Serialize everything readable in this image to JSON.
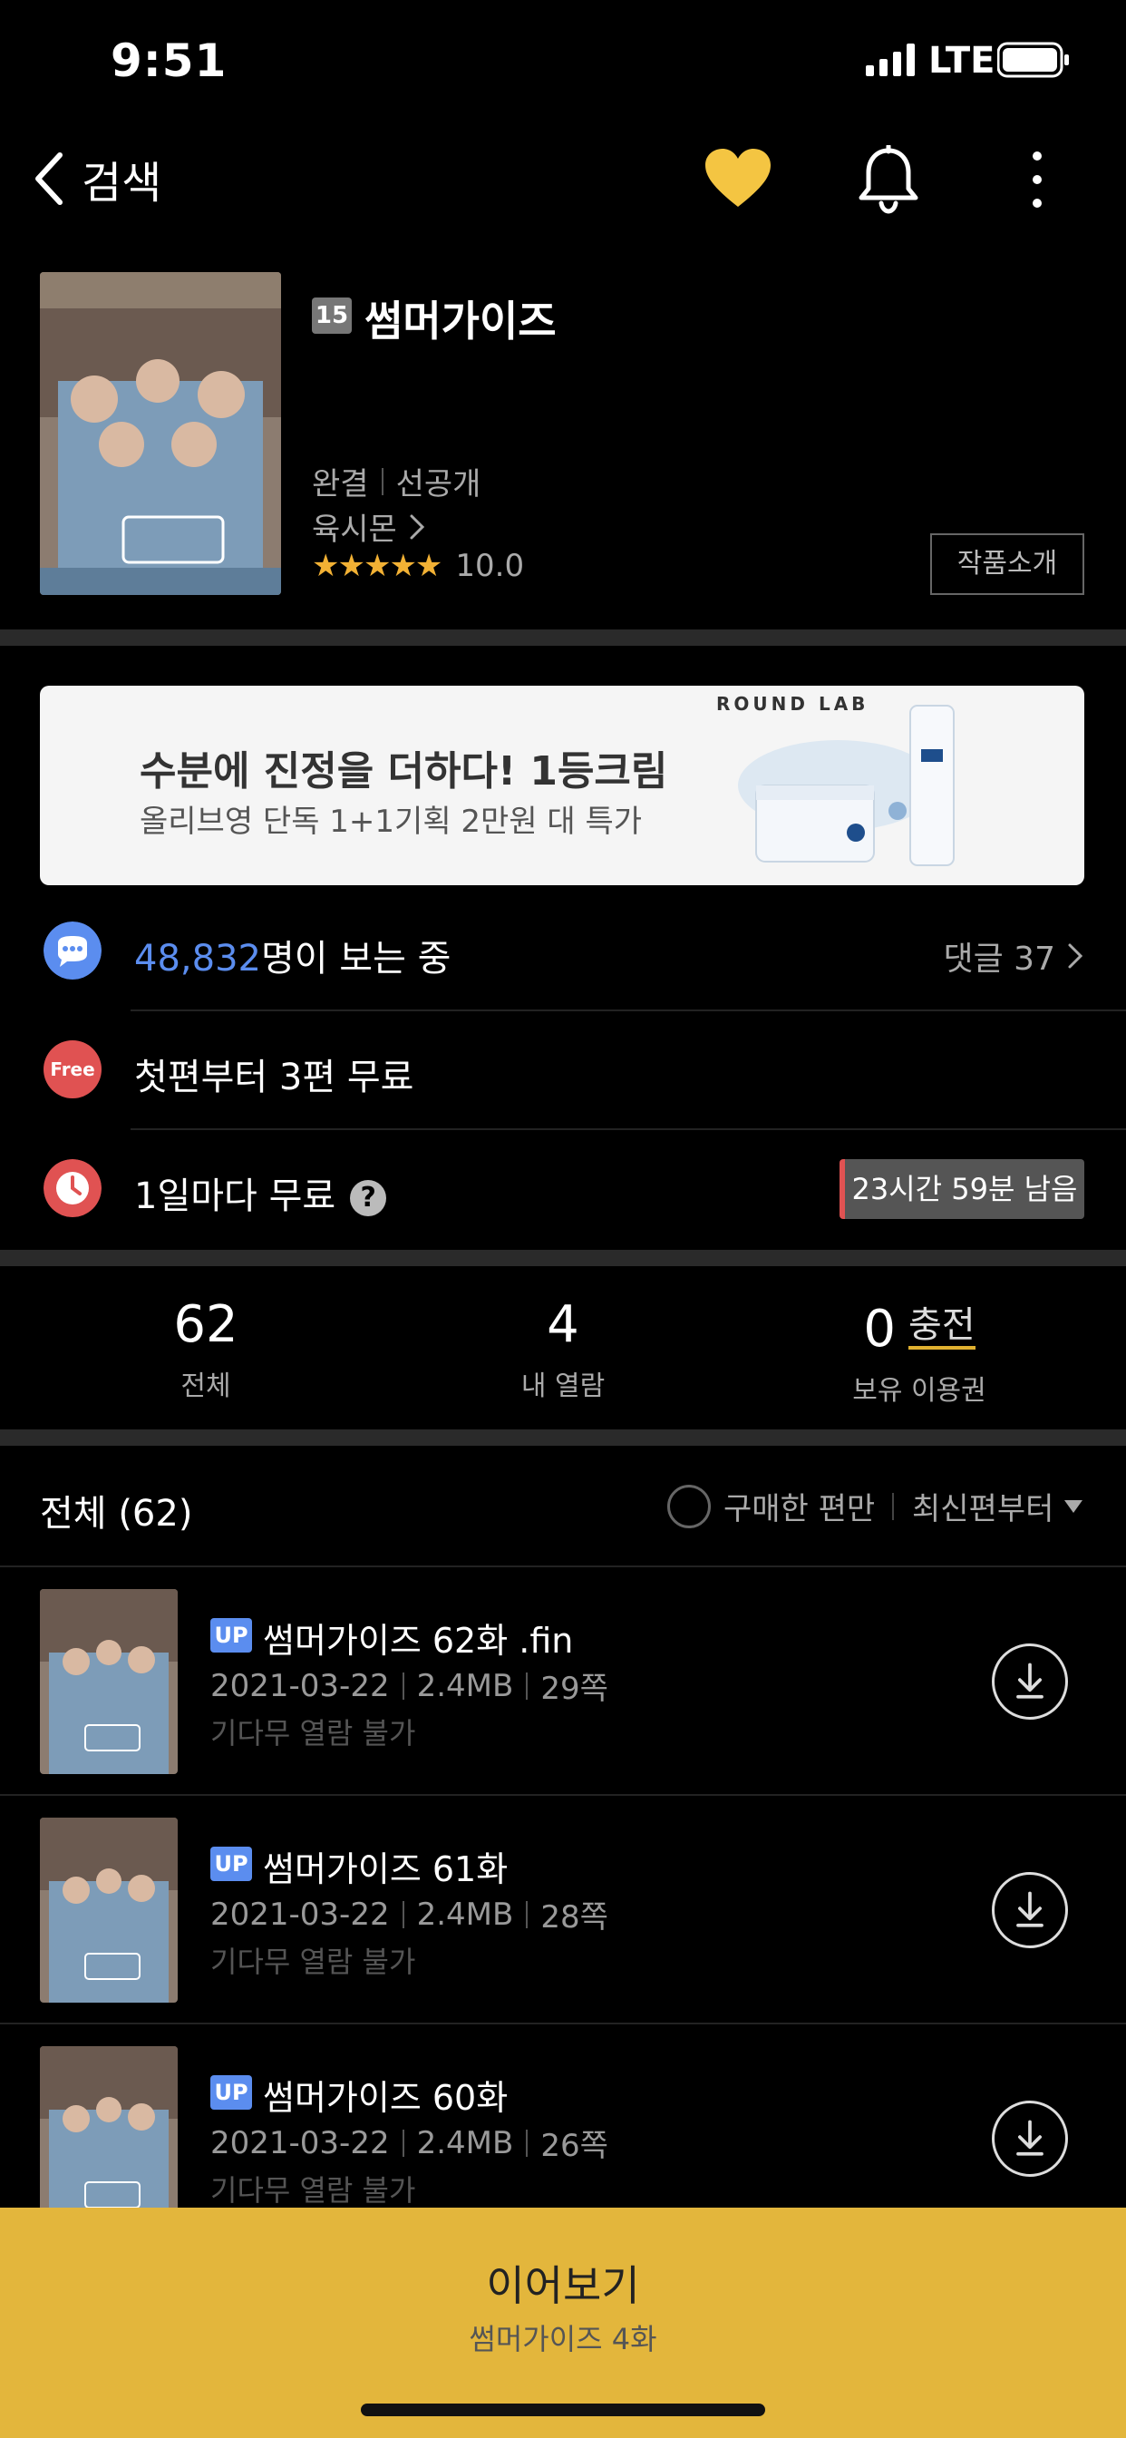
{
  "status_bar": {
    "time": "9:51",
    "network": "LTE"
  },
  "nav": {
    "back_label": "검색"
  },
  "header": {
    "age_rating": "15",
    "title": "썸머가이즈",
    "status": "완결",
    "release": "선공개",
    "author": "육시몬",
    "stars": "★★★★★",
    "rating": "10.0",
    "intro_button": "작품소개"
  },
  "ad": {
    "headline": "수분에 진정을 더하다! 1등크림",
    "sub": "올리브영 단독 1+1기획 2만원 대 특가",
    "brand": "ROUND LAB"
  },
  "info": {
    "viewer_count": "48,832",
    "viewer_suffix": "명이 보는 중",
    "comments": "댓글 37",
    "free_badge": "Free",
    "free_text": "첫편부터 3편 무료",
    "wait_text": "1일마다 무료",
    "help": "?",
    "timer": "23시간 59분 남음"
  },
  "stats": [
    {
      "value": "62",
      "label": "전체"
    },
    {
      "value": "4",
      "label": "내 열람"
    },
    {
      "value": "0",
      "label": "보유 이용권",
      "action": "충전"
    }
  ],
  "list": {
    "title": "전체 (62)",
    "filter_label": "구매한 편만",
    "sort_label": "최신편부터"
  },
  "episodes": [
    {
      "badge": "UP",
      "title": "썸머가이즈 62화 .fin",
      "date": "2021-03-22",
      "size": "2.4MB",
      "pages": "29쪽",
      "note": "기다무 열람 불가"
    },
    {
      "badge": "UP",
      "title": "썸머가이즈 61화",
      "date": "2021-03-22",
      "size": "2.4MB",
      "pages": "28쪽",
      "note": "기다무 열람 불가"
    },
    {
      "badge": "UP",
      "title": "썸머가이즈 60화",
      "date": "2021-03-22",
      "size": "2.4MB",
      "pages": "26쪽",
      "note": "기다무 열람 불가"
    }
  ],
  "continue": {
    "label": "이어보기",
    "sub": "썸머가이즈 4화"
  },
  "colors": {
    "accent": "#e3b63c",
    "heart": "#f4c542",
    "link_blue": "#5b8def",
    "timer_red": "#e05252"
  }
}
